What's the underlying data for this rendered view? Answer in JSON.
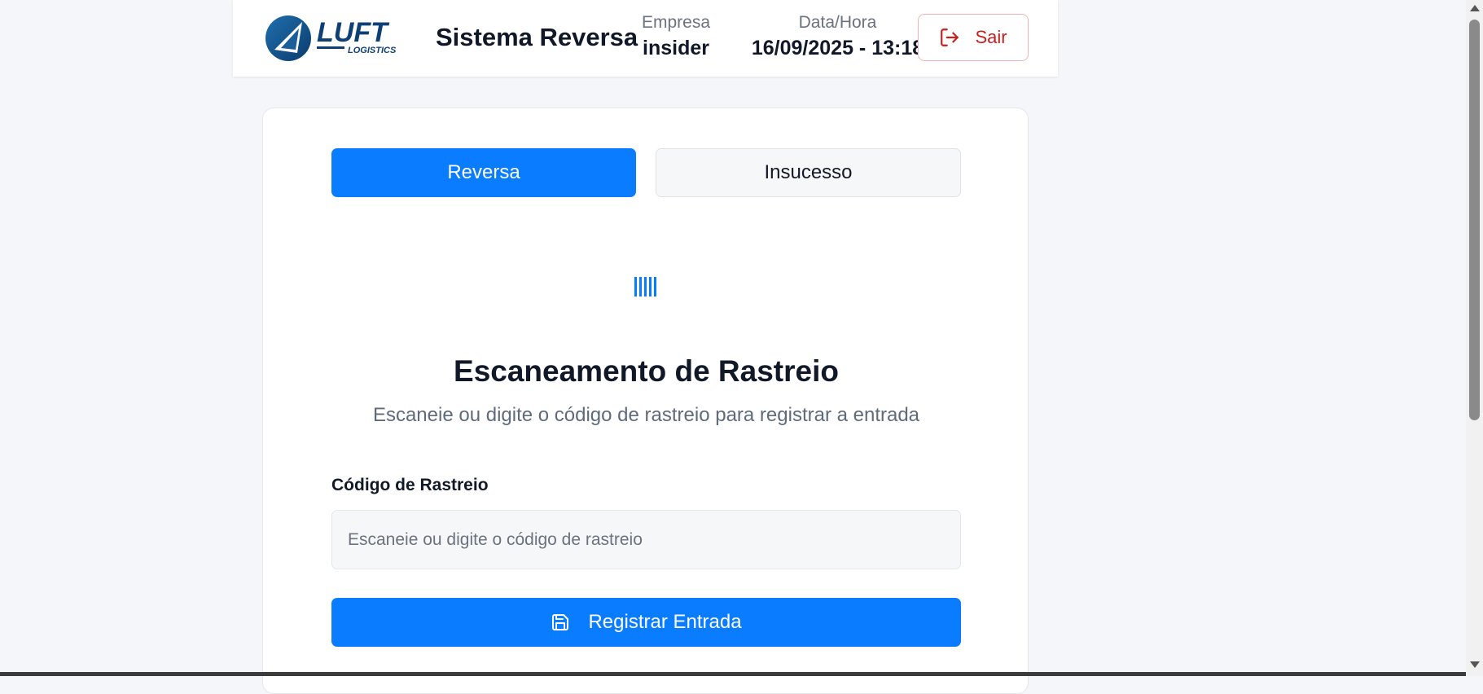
{
  "header": {
    "logo_text": "LUFT",
    "logo_subtext": "LOGISTICS",
    "app_title": "Sistema Reversa",
    "empresa_label": "Empresa",
    "empresa_value": "insider",
    "datahora_label": "Data/Hora",
    "datahora_value": "16/09/2025 - 13:18",
    "logout_label": "Sair"
  },
  "tabs": [
    {
      "label": "Reversa",
      "active": true
    },
    {
      "label": "Insucesso",
      "active": false
    }
  ],
  "scan": {
    "icon": "barcode-icon",
    "title": "Escaneamento de Rastreio",
    "subtitle": "Escaneie ou digite o código de rastreio para registrar a entrada"
  },
  "form": {
    "field_label": "Código de Rastreio",
    "input_value": "",
    "input_placeholder": "Escaneie ou digite o código de rastreio",
    "submit_label": "Registrar Entrada",
    "submit_icon": "save-icon"
  },
  "colors": {
    "primary": "#0a7cff",
    "danger": "#c81e1e",
    "background": "#f4f6f9"
  }
}
